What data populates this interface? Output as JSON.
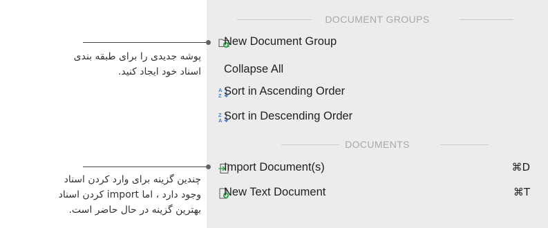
{
  "menu": {
    "sections": [
      {
        "title": "DOCUMENT GROUPS",
        "items": [
          {
            "label": "New Document Group",
            "icon": "new-group-icon"
          },
          {
            "label": "Collapse All",
            "icon": ""
          },
          {
            "label": "Sort in Ascending Order",
            "icon": "sort-ascending-icon"
          },
          {
            "label": "Sort in Descending Order",
            "icon": "sort-descending-icon"
          }
        ]
      },
      {
        "title": "DOCUMENTS",
        "items": [
          {
            "label": "Import Document(s)",
            "shortcut": "⌘D",
            "icon": "import-icon"
          },
          {
            "label": "New Text Document",
            "shortcut": "⌘T",
            "icon": "new-text-document-icon"
          }
        ]
      }
    ]
  },
  "annotations": {
    "top": {
      "line1": "پوشه جدیدی را برای طبقه بندی",
      "line2": "اسناد خود ایجاد کنید."
    },
    "bottom": {
      "line1": "چندین گزینه برای وارد کردن اسناد",
      "line2": "وجود دارد ، اما  import کردن اسناد",
      "line3": "بهترین گزینه در حال حاضر است."
    }
  },
  "colors": {
    "menu_bg": "#ececec",
    "header_text": "#a8a8a8",
    "icon_green": "#3aa852",
    "icon_blue": "#3a7bd5"
  }
}
